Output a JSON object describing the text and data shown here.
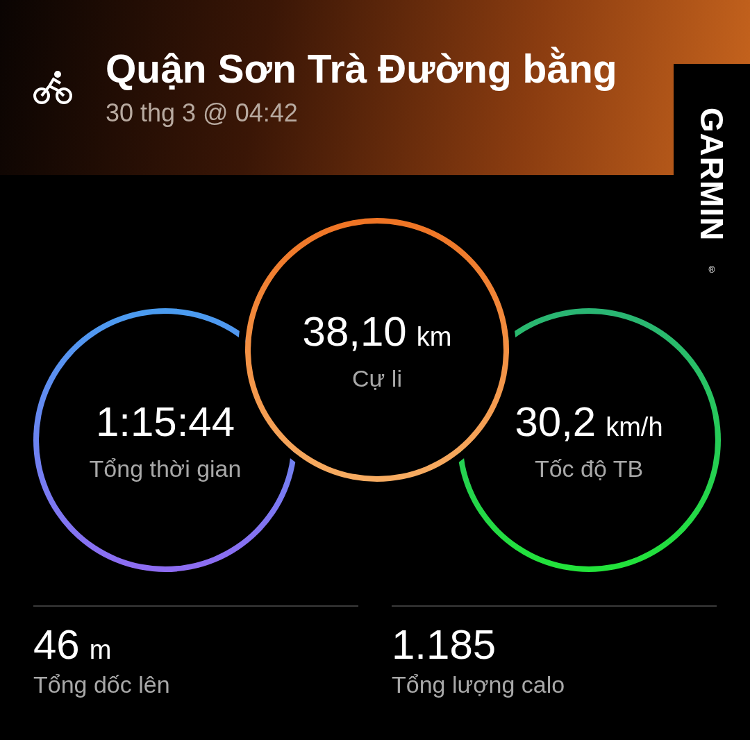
{
  "header": {
    "title": "Quận Sơn Trà Đường bằng",
    "date": "30 thg 3 @ 04:42"
  },
  "brand": {
    "logo": "GARMIN",
    "mark": "®"
  },
  "rings": [
    {
      "kind": "left",
      "value": "1:15:44",
      "label": "Tổng thời gian"
    },
    {
      "kind": "center",
      "value": "38,10",
      "unit": "km",
      "label": "Cự li"
    },
    {
      "kind": "right",
      "value": "30,2",
      "unit": "km/h",
      "label": "Tốc độ TB"
    }
  ],
  "stats": [
    {
      "value": "46",
      "unit": "m",
      "label": "Tổng dốc lên"
    },
    {
      "value": "1.185",
      "label": "Tổng lượng calo"
    }
  ]
}
